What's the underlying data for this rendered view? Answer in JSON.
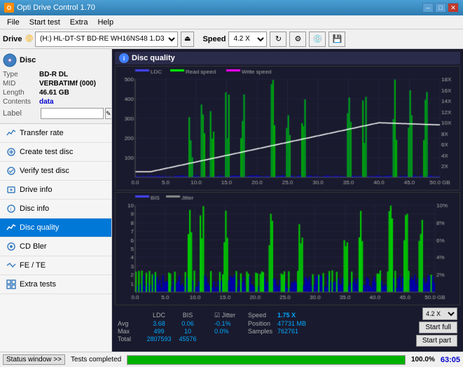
{
  "titlebar": {
    "title": "Opti Drive Control 1.70",
    "icon_text": "O",
    "minimize": "–",
    "maximize": "□",
    "close": "✕"
  },
  "menubar": {
    "items": [
      "File",
      "Start test",
      "Extra",
      "Help"
    ]
  },
  "toolbar": {
    "drive_label": "Drive",
    "drive_value": "(H:) HL-DT-ST BD-RE  WH16NS48 1.D3",
    "speed_label": "Speed",
    "speed_value": "4.2 X"
  },
  "disc": {
    "type_label": "Type",
    "type_value": "BD-R DL",
    "mid_label": "MID",
    "mid_value": "VERBATIMf (000)",
    "length_label": "Length",
    "length_value": "46.61 GB",
    "contents_label": "Contents",
    "contents_value": "data",
    "label_label": "Label",
    "label_value": ""
  },
  "nav": {
    "items": [
      {
        "label": "Transfer rate",
        "active": false
      },
      {
        "label": "Create test disc",
        "active": false
      },
      {
        "label": "Verify test disc",
        "active": false
      },
      {
        "label": "Drive info",
        "active": false
      },
      {
        "label": "Disc info",
        "active": false
      },
      {
        "label": "Disc quality",
        "active": true
      },
      {
        "label": "CD Bler",
        "active": false
      },
      {
        "label": "FE / TE",
        "active": false
      },
      {
        "label": "Extra tests",
        "active": false
      }
    ]
  },
  "chart": {
    "title": "Disc quality",
    "top_legend": {
      "ldc_label": "LDC",
      "read_label": "Read speed",
      "write_label": "Write speed"
    },
    "bottom_legend": {
      "bis_label": "BIS",
      "jitter_label": "Jitter"
    },
    "top_ymax": 500,
    "top_ymax2": 18,
    "bottom_ymax": 10,
    "bottom_ymax2": 10,
    "xmax": 50
  },
  "stats": {
    "col_ldc": "LDC",
    "col_bis": "BIS",
    "col_jitter": "Jitter",
    "row_avg_label": "Avg",
    "row_avg_ldc": "3.68",
    "row_avg_bis": "0.06",
    "row_avg_jitter": "-0.1%",
    "row_max_label": "Max",
    "row_max_ldc": "499",
    "row_max_bis": "10",
    "row_max_jitter": "0.0%",
    "row_total_label": "Total",
    "row_total_ldc": "2807593",
    "row_total_bis": "45576",
    "speed_label": "Speed",
    "speed_value": "1.75 X",
    "position_label": "Position",
    "position_value": "47731 MB",
    "samples_label": "Samples",
    "samples_value": "762761",
    "speed_select": "4.2 X",
    "start_full": "Start full",
    "start_part": "Start part"
  },
  "statusbar": {
    "status_btn": "Status window >>",
    "progress": 100,
    "status_text": "Tests completed",
    "time": "63:05"
  }
}
